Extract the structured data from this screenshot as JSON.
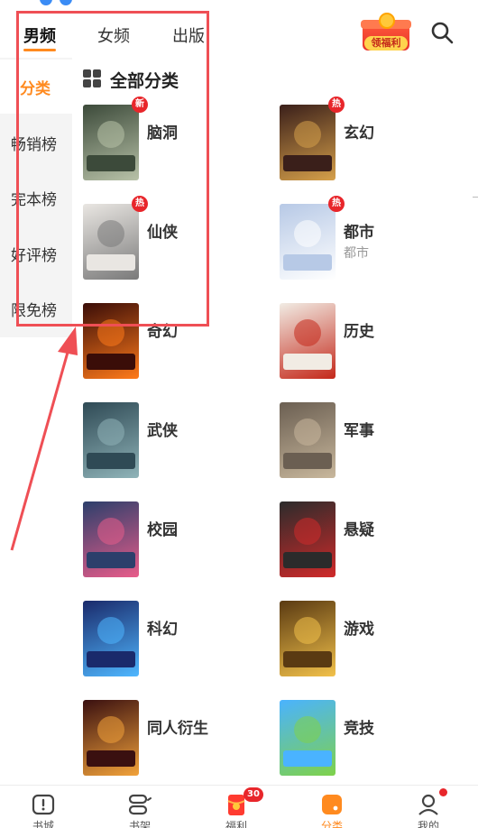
{
  "top_tabs": [
    {
      "label": "男频",
      "active": true
    },
    {
      "label": "女频",
      "active": false
    },
    {
      "label": "出版",
      "active": false
    }
  ],
  "welfare": {
    "label": "领福利",
    "icon": "gift-box-icon"
  },
  "search": {
    "icon": "search-icon"
  },
  "sidebar": [
    {
      "label": "分类",
      "active": true
    },
    {
      "label": "畅销榜",
      "active": false
    },
    {
      "label": "完本榜",
      "active": false
    },
    {
      "label": "好评榜",
      "active": false
    },
    {
      "label": "限免榜",
      "active": false
    }
  ],
  "section": {
    "title": "全部分类",
    "icon": "grid-icon"
  },
  "categories": [
    {
      "name": "脑洞",
      "badge": "新",
      "sub": "",
      "cover": [
        "#3c4a3a",
        "#b8c2a8"
      ]
    },
    {
      "name": "玄幻",
      "badge": "热",
      "sub": "",
      "cover": [
        "#3a1f1a",
        "#d6a04a"
      ]
    },
    {
      "name": "仙侠",
      "badge": "热",
      "sub": "",
      "cover": [
        "#e9e6e2",
        "#7a7a7a"
      ]
    },
    {
      "name": "都市",
      "badge": "热",
      "sub": "都市",
      "cover": [
        "#b7c9e6",
        "#ffffff"
      ]
    },
    {
      "name": "奇幻",
      "badge": "",
      "sub": "",
      "cover": [
        "#3a0d08",
        "#ff7a1a"
      ]
    },
    {
      "name": "历史",
      "badge": "",
      "sub": "",
      "cover": [
        "#f1ece4",
        "#c4281a"
      ]
    },
    {
      "name": "武侠",
      "badge": "",
      "sub": "",
      "cover": [
        "#2f4a55",
        "#8fb3b8"
      ]
    },
    {
      "name": "军事",
      "badge": "",
      "sub": "",
      "cover": [
        "#6b5f52",
        "#c8b79c"
      ]
    },
    {
      "name": "校园",
      "badge": "",
      "sub": "",
      "cover": [
        "#2c3f6b",
        "#e85c8a"
      ]
    },
    {
      "name": "悬疑",
      "badge": "",
      "sub": "",
      "cover": [
        "#2b2b2b",
        "#d02a2a"
      ]
    },
    {
      "name": "科幻",
      "badge": "",
      "sub": "",
      "cover": [
        "#1a2a6b",
        "#4fb7ff"
      ]
    },
    {
      "name": "游戏",
      "badge": "",
      "sub": "",
      "cover": [
        "#5a3a12",
        "#f2c14a"
      ]
    },
    {
      "name": "同人衍生",
      "badge": "",
      "sub": "",
      "cover": [
        "#3a1010",
        "#f2a23a"
      ]
    },
    {
      "name": "竞技",
      "badge": "",
      "sub": "",
      "cover": [
        "#4ab3ff",
        "#7fd24a"
      ]
    }
  ],
  "bottom_nav": [
    {
      "label": "书城",
      "icon": "bookstore-icon",
      "active": false,
      "badge": ""
    },
    {
      "label": "书架",
      "icon": "bookshelf-icon",
      "active": false,
      "badge": ""
    },
    {
      "label": "福利",
      "icon": "red-envelope-icon",
      "active": false,
      "badge": "30"
    },
    {
      "label": "分类",
      "icon": "category-icon",
      "active": true,
      "badge": ""
    },
    {
      "label": "我的",
      "icon": "profile-icon",
      "active": false,
      "badge": ""
    }
  ],
  "colors": {
    "accent": "#ff8a1f",
    "annotation": "#ef4f55",
    "badge": "#e8262b"
  }
}
